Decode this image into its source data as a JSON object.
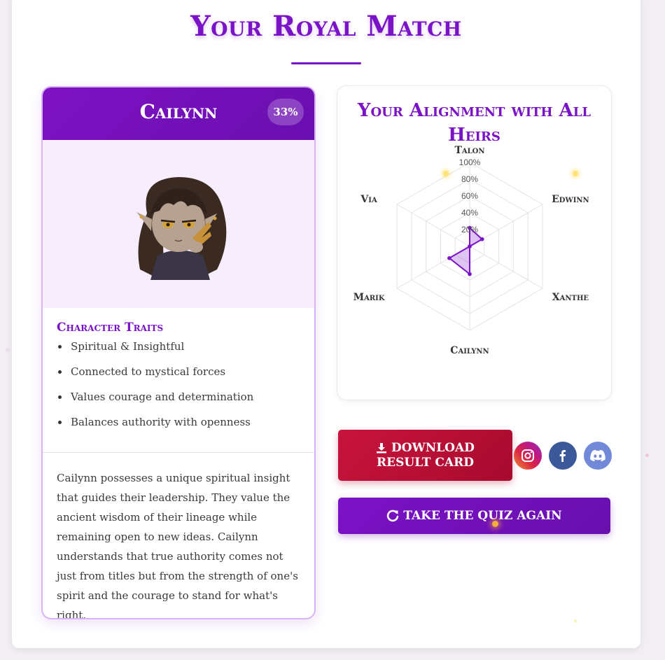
{
  "page": {
    "title": "Your Royal Match"
  },
  "result": {
    "name": "Cailynn",
    "match_percent": "33%",
    "traits_title": "Character Traits",
    "traits": [
      "Spiritual & Insightful",
      "Connected to mystical forces",
      "Values courage and determination",
      "Balances authority with openness"
    ],
    "description": "Cailynn possesses a unique spiritual insight that guides their leadership. They value the ancient wisdom of their lineage while remaining open to new ideas. Cailynn understands that true authority comes not just from titles but from the strength of one's spirit and the courage to stand for what's right."
  },
  "alignment": {
    "title": "Your Alignment with All Heirs"
  },
  "chart_data": {
    "type": "radar",
    "title": "Your Alignment with All Heirs",
    "axes": [
      "Talon",
      "Edwinn",
      "Xanthe",
      "Cailynn",
      "Marik",
      "Via"
    ],
    "ticks": [
      "20%",
      "40%",
      "60%",
      "80%",
      "100%"
    ],
    "range": [
      0,
      100
    ],
    "series": [
      {
        "values": [
          22,
          17,
          0,
          33,
          28,
          0
        ]
      }
    ],
    "colors": {
      "fill": "rgba(122,18,200,0.25)",
      "stroke": "#7a12c8"
    }
  },
  "actions": {
    "download_label_line1": "DOWNLOAD",
    "download_label_line2": "RESULT CARD",
    "retake_label": "TAKE THE QUIZ AGAIN"
  },
  "social": {
    "instagram_icon": "instagram-icon",
    "facebook_icon": "facebook-icon",
    "discord_icon": "discord-icon"
  },
  "colors": {
    "accent": "#7a12c8",
    "download": "#c8143c"
  }
}
